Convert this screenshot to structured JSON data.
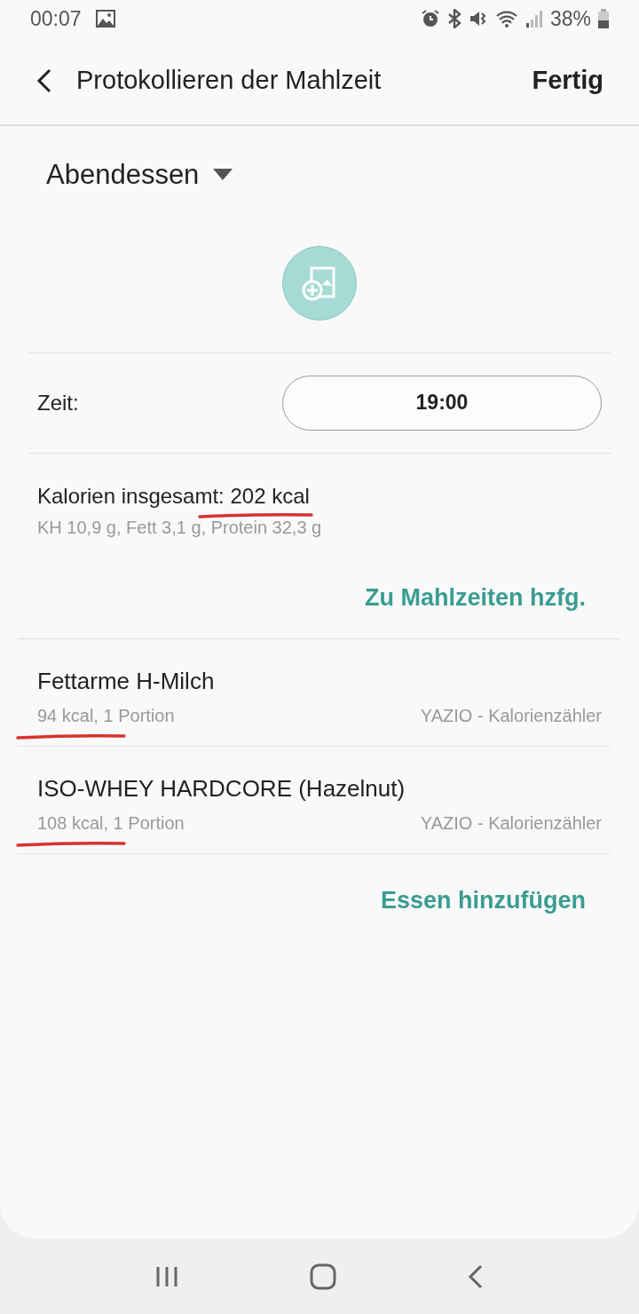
{
  "status_bar": {
    "time": "00:07",
    "battery": "38%"
  },
  "header": {
    "title": "Protokollieren der Mahlzeit",
    "action": "Fertig"
  },
  "meal": {
    "label": "Abendessen"
  },
  "time_row": {
    "label": "Zeit:",
    "value": "19:00"
  },
  "totals": {
    "calories_label": "Kalorien insgesamt: ",
    "calories": "202 kcal",
    "annotated": true,
    "macros": "KH 10,9 g, Fett 3,1 g, Protein 32,3 g"
  },
  "add_to_meals": "Zu Mahlzeiten hzfg.",
  "items": [
    {
      "name": "Fettarme H-Milch",
      "detail": "94 kcal, 1 Portion",
      "source": "YAZIO - Kalorienzähler",
      "annotated": true
    },
    {
      "name": "ISO-WHEY HARDCORE (Hazelnut)",
      "detail": "108 kcal, 1 Portion",
      "source": "YAZIO - Kalorienzähler",
      "annotated": true
    }
  ],
  "add_food": "Essen hinzufügen"
}
